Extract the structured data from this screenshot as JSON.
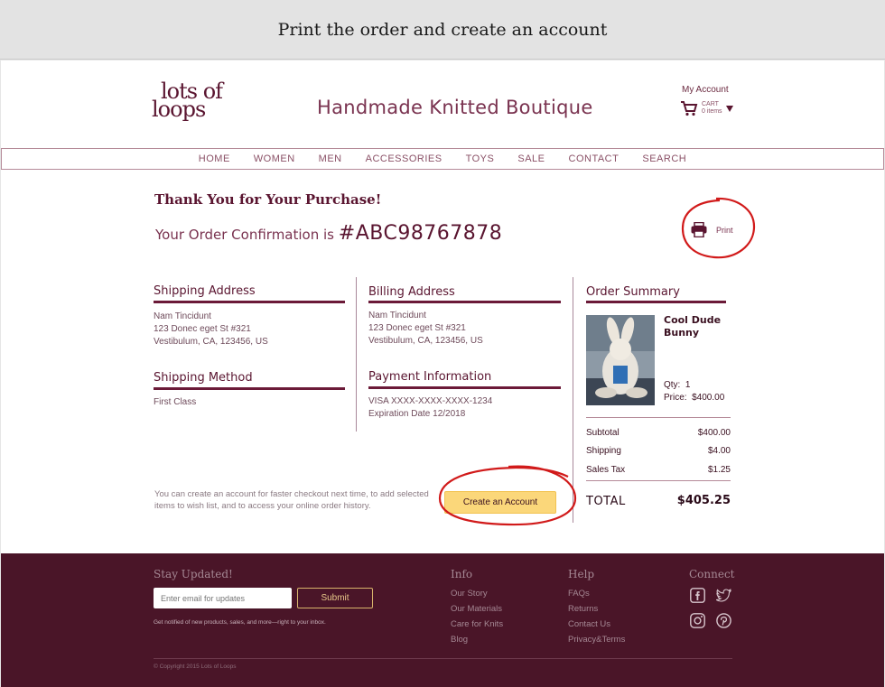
{
  "caption": "Print the order and create an account",
  "brand": {
    "logo_line1": "lots of",
    "logo_line2": "loops",
    "title": "Handmade Knitted Boutique"
  },
  "header": {
    "my_account": "My Account",
    "cart_label": "CART",
    "cart_count": "0 items"
  },
  "nav": [
    "HOME",
    "WOMEN",
    "MEN",
    "ACCESSORIES",
    "TOYS",
    "SALE",
    "CONTACT",
    "SEARCH"
  ],
  "confirmation": {
    "thank_you": "Thank You for Your Purchase!",
    "order_prefix": "Your Order Confirmation is",
    "order_number": "#ABC98767878",
    "print_label": "Print"
  },
  "shipping_address": {
    "title": "Shipping Address",
    "lines": [
      "Nam Tincidunt",
      "123 Donec eget St #321",
      "Vestibulum, CA, 123456, US"
    ]
  },
  "billing_address": {
    "title": "Billing Address",
    "lines": [
      "Nam Tincidunt",
      "123 Donec eget St #321",
      "Vestibulum, CA, 123456, US"
    ]
  },
  "shipping_method": {
    "title": "Shipping Method",
    "value": "First Class"
  },
  "payment": {
    "title": "Payment Information",
    "card": "VISA XXXX-XXXX-XXXX-1234",
    "expiration": "Expiration Date 12/2018"
  },
  "order_summary": {
    "title": "Order Summary",
    "product_name": "Cool Dude Bunny",
    "qty_label": "Qty:",
    "qty": "1",
    "price_label": "Price:",
    "price": "$400.00",
    "rows": [
      {
        "label": "Subtotal",
        "value": "$400.00"
      },
      {
        "label": "Shipping",
        "value": "$4.00"
      },
      {
        "label": "Sales Tax",
        "value": "$1.25"
      }
    ],
    "total_label": "TOTAL",
    "total_value": "$405.25"
  },
  "create_account": {
    "note": "You can create an account for faster checkout next time, to add selected items to wish list, and to access your online order history.",
    "button": "Create an Account"
  },
  "footer": {
    "stay_updated": "Stay Updated!",
    "email_placeholder": "Enter email for updates",
    "submit": "Submit",
    "note": "Get notified of new products, sales, and more—right to your inbox.",
    "info_title": "Info",
    "info_links": [
      "Our Story",
      "Our Materials",
      "Care for Knits",
      "Blog"
    ],
    "help_title": "Help",
    "help_links": [
      "FAQs",
      "Returns",
      "Contact Us",
      "Privacy&Terms"
    ],
    "connect_title": "Connect",
    "copyright": "© Copyright 2015 Lots of Loops"
  },
  "colors": {
    "brand": "#5a1530",
    "footer_bg": "#4a1528",
    "accent_button": "#fbd77a",
    "annotation_red": "#d11a1a"
  },
  "icons": [
    "cart-icon",
    "printer-icon",
    "facebook-icon",
    "twitter-icon",
    "instagram-icon",
    "pinterest-icon"
  ]
}
